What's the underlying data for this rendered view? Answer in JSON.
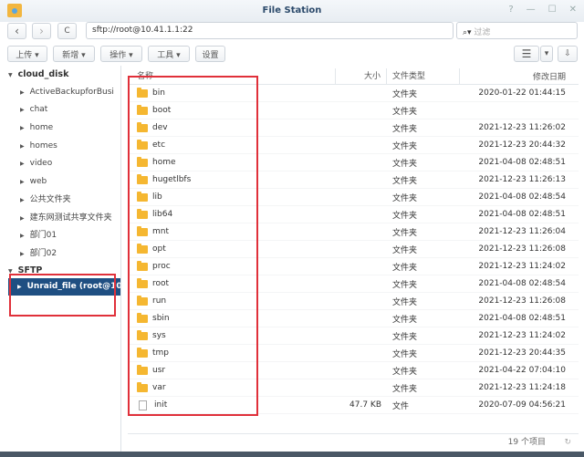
{
  "window": {
    "title": "File Station",
    "controls": [
      "?",
      "—",
      "☐",
      "✕"
    ]
  },
  "nav": {
    "back": "‹",
    "forward": "›",
    "refresh": "C",
    "address": "sftp://root@10.41.1.1:22",
    "search_placeholder": "过滤"
  },
  "toolbar": {
    "upload": "上传 ▾",
    "create": "新增 ▾",
    "action": "操作 ▾",
    "tools": "工具 ▾",
    "settings": "设置",
    "view": "☰",
    "view_dropdown": "▾",
    "sort": "⇩"
  },
  "sidebar": {
    "root": "cloud_disk",
    "items": [
      "ActiveBackupforBusi",
      "chat",
      "home",
      "homes",
      "video",
      "web",
      "公共文件夹",
      "建东网测试共享文件夹",
      "部门01",
      "部门02"
    ],
    "sftp_root": "SFTP",
    "sftp_item": "Unraid_file (root@10"
  },
  "columns": {
    "name": "名称",
    "size": "大小",
    "type": "文件类型",
    "date": "修改日期"
  },
  "files": [
    {
      "name": "bin",
      "size": "",
      "type": "文件夹",
      "date": "2020-01-22 01:44:15",
      "kind": "folder"
    },
    {
      "name": "boot",
      "size": "",
      "type": "文件夹",
      "date": "",
      "kind": "folder"
    },
    {
      "name": "dev",
      "size": "",
      "type": "文件夹",
      "date": "2021-12-23 11:26:02",
      "kind": "folder"
    },
    {
      "name": "etc",
      "size": "",
      "type": "文件夹",
      "date": "2021-12-23 20:44:32",
      "kind": "folder"
    },
    {
      "name": "home",
      "size": "",
      "type": "文件夹",
      "date": "2021-04-08 02:48:51",
      "kind": "folder"
    },
    {
      "name": "hugetlbfs",
      "size": "",
      "type": "文件夹",
      "date": "2021-12-23 11:26:13",
      "kind": "folder"
    },
    {
      "name": "lib",
      "size": "",
      "type": "文件夹",
      "date": "2021-04-08 02:48:54",
      "kind": "folder"
    },
    {
      "name": "lib64",
      "size": "",
      "type": "文件夹",
      "date": "2021-04-08 02:48:51",
      "kind": "folder"
    },
    {
      "name": "mnt",
      "size": "",
      "type": "文件夹",
      "date": "2021-12-23 11:26:04",
      "kind": "folder"
    },
    {
      "name": "opt",
      "size": "",
      "type": "文件夹",
      "date": "2021-12-23 11:26:08",
      "kind": "folder"
    },
    {
      "name": "proc",
      "size": "",
      "type": "文件夹",
      "date": "2021-12-23 11:24:02",
      "kind": "folder"
    },
    {
      "name": "root",
      "size": "",
      "type": "文件夹",
      "date": "2021-04-08 02:48:54",
      "kind": "folder"
    },
    {
      "name": "run",
      "size": "",
      "type": "文件夹",
      "date": "2021-12-23 11:26:08",
      "kind": "folder"
    },
    {
      "name": "sbin",
      "size": "",
      "type": "文件夹",
      "date": "2021-04-08 02:48:51",
      "kind": "folder"
    },
    {
      "name": "sys",
      "size": "",
      "type": "文件夹",
      "date": "2021-12-23 11:24:02",
      "kind": "folder"
    },
    {
      "name": "tmp",
      "size": "",
      "type": "文件夹",
      "date": "2021-12-23 20:44:35",
      "kind": "folder"
    },
    {
      "name": "usr",
      "size": "",
      "type": "文件夹",
      "date": "2021-04-22 07:04:10",
      "kind": "folder"
    },
    {
      "name": "var",
      "size": "",
      "type": "文件夹",
      "date": "2021-12-23 11:24:18",
      "kind": "folder"
    },
    {
      "name": "init",
      "size": "47.7 KB",
      "type": "文件",
      "date": "2020-07-09 04:56:21",
      "kind": "file"
    }
  ],
  "status": {
    "count": "19 个项目",
    "refresh": "↻"
  },
  "colors": {
    "selected": "#1f4f82",
    "annotation": "#e0303a",
    "folder": "#f5b731"
  }
}
